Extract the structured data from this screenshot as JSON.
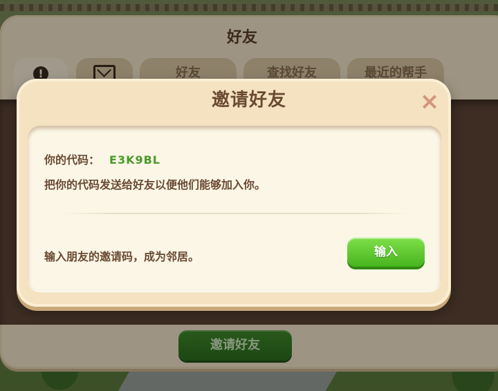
{
  "friends_panel": {
    "title": "好友",
    "tabs": [
      {
        "label": "",
        "icon": "alert-icon"
      },
      {
        "label": "",
        "icon": "mail-icon"
      },
      {
        "label": "好友"
      },
      {
        "label": "查找好友"
      },
      {
        "label": "最近的帮手"
      }
    ],
    "invite_button": "邀请好友"
  },
  "dialog": {
    "title": "邀请好友",
    "close_icon": "×",
    "code_label": "你的代码：",
    "code_value": "E3K9BL",
    "description": "把你的代码发送给好友以便他们能够加入你。",
    "enter_prompt": "输入朋友的邀请码，成为邻居。",
    "enter_button": "输入"
  },
  "colors": {
    "panel_bg": "#f4e2c0",
    "text_brown": "#6b4a33",
    "code_green": "#4a9a2a",
    "button_green": "#48b41e"
  }
}
